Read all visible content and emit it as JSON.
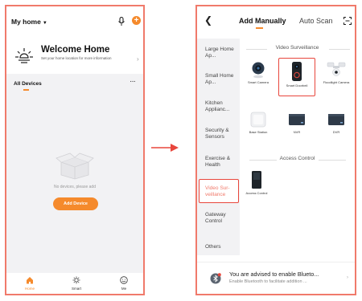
{
  "left_screen": {
    "home_title": "My home",
    "welcome": {
      "title": "Welcome Home",
      "subtitle": "Set your home location for more information"
    },
    "devices_header": "All Devices",
    "empty_text": "No devices, please add",
    "add_button": "Add Device",
    "tabs": [
      {
        "label": "Home",
        "icon": "home-icon"
      },
      {
        "label": "Smart",
        "icon": "sun-icon"
      },
      {
        "label": "Me",
        "icon": "smiley-icon"
      }
    ]
  },
  "right_screen": {
    "tabs": {
      "manual": "Add Manually",
      "auto": "Auto Scan"
    },
    "categories": [
      {
        "label": "Large Home Ap..."
      },
      {
        "label": "Small Home Ap..."
      },
      {
        "label": "Kitchen Applianc..."
      },
      {
        "label": "Security & Sensors"
      },
      {
        "label": "Exercise & Health"
      },
      {
        "label": "Video Sur-veillance",
        "selected": true
      },
      {
        "label": "Gateway Control"
      },
      {
        "label": "Others"
      }
    ],
    "sections": [
      {
        "title": "Video Surveillance",
        "devices": [
          {
            "label": "Smart Camera",
            "icon": "smart-camera-icon"
          },
          {
            "label": "Smart Doorbell",
            "icon": "doorbell-icon",
            "selected": true
          },
          {
            "label": "Floodlight Camera",
            "icon": "floodlight-camera-icon"
          },
          {
            "label": "Base Station",
            "icon": "base-station-icon"
          },
          {
            "label": "NVR",
            "icon": "nvr-icon"
          },
          {
            "label": "DVR",
            "icon": "dvr-icon"
          }
        ]
      },
      {
        "title": "Access Control",
        "devices": [
          {
            "label": "Access Control",
            "icon": "access-control-icon"
          }
        ]
      }
    ],
    "bluetooth_banner": {
      "title": "You are advised to enable Blueto...",
      "subtitle": "Enable Bluetooth to facilitate addition ..."
    }
  },
  "colors": {
    "accent": "#f58a2c",
    "highlight_border": "#e8463c",
    "background": "#f2f2f4"
  }
}
